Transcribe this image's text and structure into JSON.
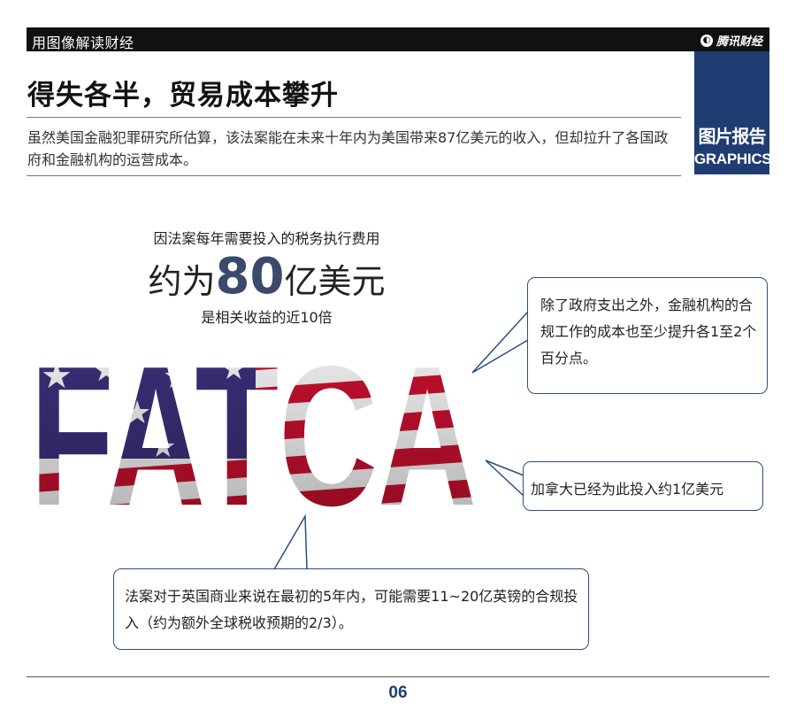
{
  "header": {
    "series_label": "用图像解读财经",
    "brand": "腾讯财经"
  },
  "badge": {
    "cn_label": "图片报告",
    "en_label": "GRAPHICS",
    "color": "#1f3d73"
  },
  "title": "得失各半，贸易成本攀升",
  "lead": "虽然美国金融犯罪研究所估算，该法案能在未来十年内为美国带来87亿美元的收入，但却拉升了各国政府和金融机构的运营成本。",
  "stat": {
    "kicker": "因法案每年需要投入的税务执行费用",
    "prefix": "约为",
    "number": "80",
    "suffix": "亿美元",
    "note": "是相关收益的近10倍"
  },
  "graphic": {
    "word": "FATCA",
    "flag_colors": {
      "red": "#c8102e",
      "white": "#f4f4f4",
      "blue": "#3c2f7a"
    }
  },
  "callouts": {
    "top_right": "除了政府支出之外，金融机构的合规工作的成本也至少提升各1至2个百分点。",
    "middle_right": "加拿大已经为此投入约1亿美元",
    "bottom": "法案对于英国商业来说在最初的5年内，可能需要11~20亿英镑的合规投入（约为额外全球税收预期的2/3）。"
  },
  "page_number": "06"
}
